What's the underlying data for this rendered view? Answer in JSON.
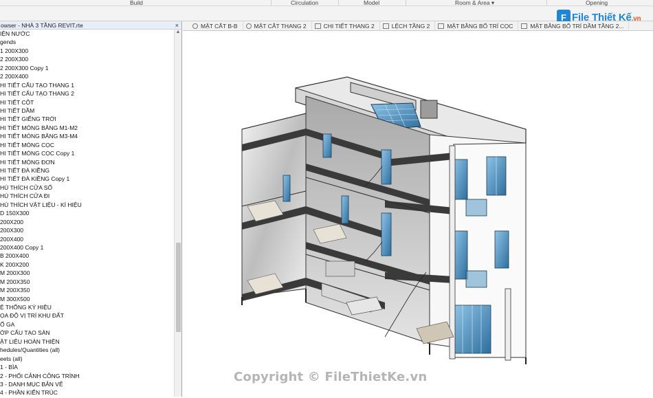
{
  "ribbon": {
    "groups": [
      "Build",
      "Circulation",
      "Model",
      "Room & Area ▾",
      "Opening"
    ]
  },
  "logo": {
    "mark": "F",
    "name": "File",
    "rest": "Thiết Kế",
    "suffix": ".vn"
  },
  "browser": {
    "title": "owser - NHÀ 3 TẦNG REVIT.rte",
    "close": "×",
    "items": [
      "IỆN NƯỚC",
      "gends",
      "1 200X300",
      "2 200X300",
      "2 200X300 Copy 1",
      "2 200X400",
      "HI TIẾT CẤU TẠO THANG 1",
      "HI TIẾT CẤU TẠO THANG 2",
      "HI TIẾT CỘT",
      "HI TIẾT DẦM",
      "HI TIẾT GIẾNG TRỜI",
      "HI TIẾT MÓNG BĂNG M1-M2",
      "HI TIẾT MÓNG BĂNG M3-M4",
      "HI TIẾT MÓNG CỌC",
      "HI TIẾT MÓNG CỌC Copy 1",
      "HI TIẾT MÓNG ĐƠN",
      "HI TIẾT ĐÀ KIỀNG",
      "HI TIẾT ĐÀ KIỀNG Copy 1",
      "HÚ THÍCH CỬA SỔ",
      "HÚ THÍCH CỬA ĐI",
      "HÚ THÍCH VẬT LIỆU - KÍ HIỆU",
      "D 150X300",
      "200X200",
      "200X300",
      "200X400",
      "200X400 Copy 1",
      "B 200X400",
      "K 200X200",
      "M 200X300",
      "M 200X350",
      "M 200X350",
      "M 300X500",
      "Ệ THỐNG KÝ HIỆU",
      "ỌA ĐỘ VỊ TRÍ KHU ĐẤT",
      "Ố GA",
      "ỚP CẤU TẠO SÀN",
      "ẬT LIỆU HOÀN THIỆN",
      "hedules/Quantities (all)",
      "eets (all)",
      "1 - BÌA",
      "2 - PHỐI CẢNH CÔNG TRÌNH",
      "3 - DANH MỤC BẢN VẼ",
      "4 - PHẦN KIẾN TRÚC"
    ]
  },
  "tabs": [
    "MẶT CẮT B-B",
    "MẶT CẮT THANG 2",
    "CHI TIẾT THANG 2",
    "LỆCH TẦNG 2",
    "MẶT BẰNG BỐ TRÍ CỌC",
    "MẶT BẰNG BỐ TRÍ DẦM TẦNG 2..."
  ],
  "watermark": "Copyright © FileThietKe.vn",
  "colors": {
    "accent": "#1f86d6",
    "glass": "#2f7fb5",
    "logo_suffix": "#e85a16"
  }
}
